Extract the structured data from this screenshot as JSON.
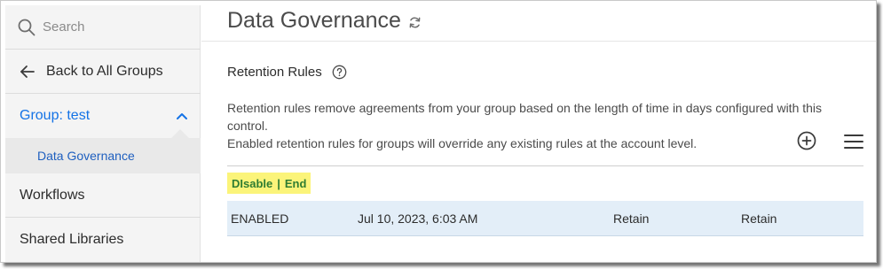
{
  "sidebar": {
    "search_placeholder": "Search",
    "back_label": "Back to All Groups",
    "group_label": "Group: test",
    "sub_item_label": "Data Governance",
    "workflows_label": "Workflows",
    "shared_libraries_label": "Shared Libraries"
  },
  "header": {
    "title": "Data Governance"
  },
  "retention": {
    "title": "Retention Rules",
    "description_line1": "Retention rules remove agreements from your group based on the length of time in days configured with this control.",
    "description_line2": "Enabled retention rules for groups will override any existing rules at the account level.",
    "actions": {
      "disable_label": "DIsable",
      "separator": "|",
      "end_label": "End"
    },
    "rows": [
      {
        "status": "ENABLED",
        "date": "Jul 10, 2023, 6:03 AM",
        "col3": "Retain",
        "col4": "Retain"
      }
    ]
  },
  "colors": {
    "accent_link": "#1473e6",
    "highlight": "#fbf47a",
    "action_text": "#2e7d32",
    "selected_row": "#e3eef8",
    "sidebar_bg": "#f4f4f4"
  },
  "icons": {
    "search": "search-icon",
    "back": "arrow-left-icon",
    "group_toggle": "chevron-up-icon",
    "refresh": "refresh-icon",
    "help": "help-icon",
    "add": "add-circle-icon",
    "menu": "menu-icon"
  }
}
